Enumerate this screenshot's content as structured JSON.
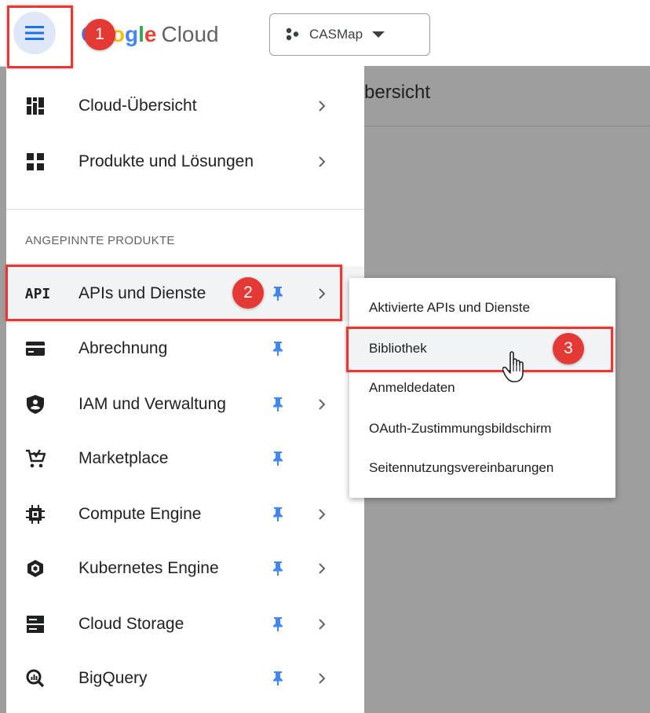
{
  "topbar": {
    "logo_prefix": "Google",
    "logo_suffix": "Cloud",
    "project": "CASMap"
  },
  "page": {
    "title_fragment": "bersicht"
  },
  "nav": {
    "top_items": [
      {
        "label": "Cloud-Übersicht",
        "icon": "dashboard-icon",
        "has_chevron": true
      },
      {
        "label": "Produkte und Lösungen",
        "icon": "grid-icon",
        "has_chevron": true
      }
    ],
    "section_title": "ANGEPINNTE PRODUKTE",
    "pinned_items": [
      {
        "label": "APIs und Dienste",
        "icon": "api-icon",
        "pinned": true,
        "has_chevron": true
      },
      {
        "label": "Abrechnung",
        "icon": "billing-icon",
        "pinned": true,
        "has_chevron": false
      },
      {
        "label": "IAM und Verwaltung",
        "icon": "shield-icon",
        "pinned": true,
        "has_chevron": true
      },
      {
        "label": "Marketplace",
        "icon": "cart-icon",
        "pinned": true,
        "has_chevron": false
      },
      {
        "label": "Compute Engine",
        "icon": "chip-icon",
        "pinned": true,
        "has_chevron": true
      },
      {
        "label": "Kubernetes Engine",
        "icon": "hexagon-icon",
        "pinned": true,
        "has_chevron": true
      },
      {
        "label": "Cloud Storage",
        "icon": "storage-icon",
        "pinned": true,
        "has_chevron": true
      },
      {
        "label": "BigQuery",
        "icon": "search-chart-icon",
        "pinned": true,
        "has_chevron": true
      }
    ]
  },
  "submenu": {
    "items": [
      {
        "label": "Aktivierte APIs und Dienste"
      },
      {
        "label": "Bibliothek"
      },
      {
        "label": "Anmeldedaten"
      },
      {
        "label": "OAuth-Zustimmungsbildschirm"
      },
      {
        "label": "Seitennutzungsvereinbarungen"
      }
    ]
  },
  "steps": {
    "one": "1",
    "two": "2",
    "three": "3"
  },
  "colors": {
    "accent_blue": "#4285f4",
    "annotation_red": "#e53935"
  }
}
